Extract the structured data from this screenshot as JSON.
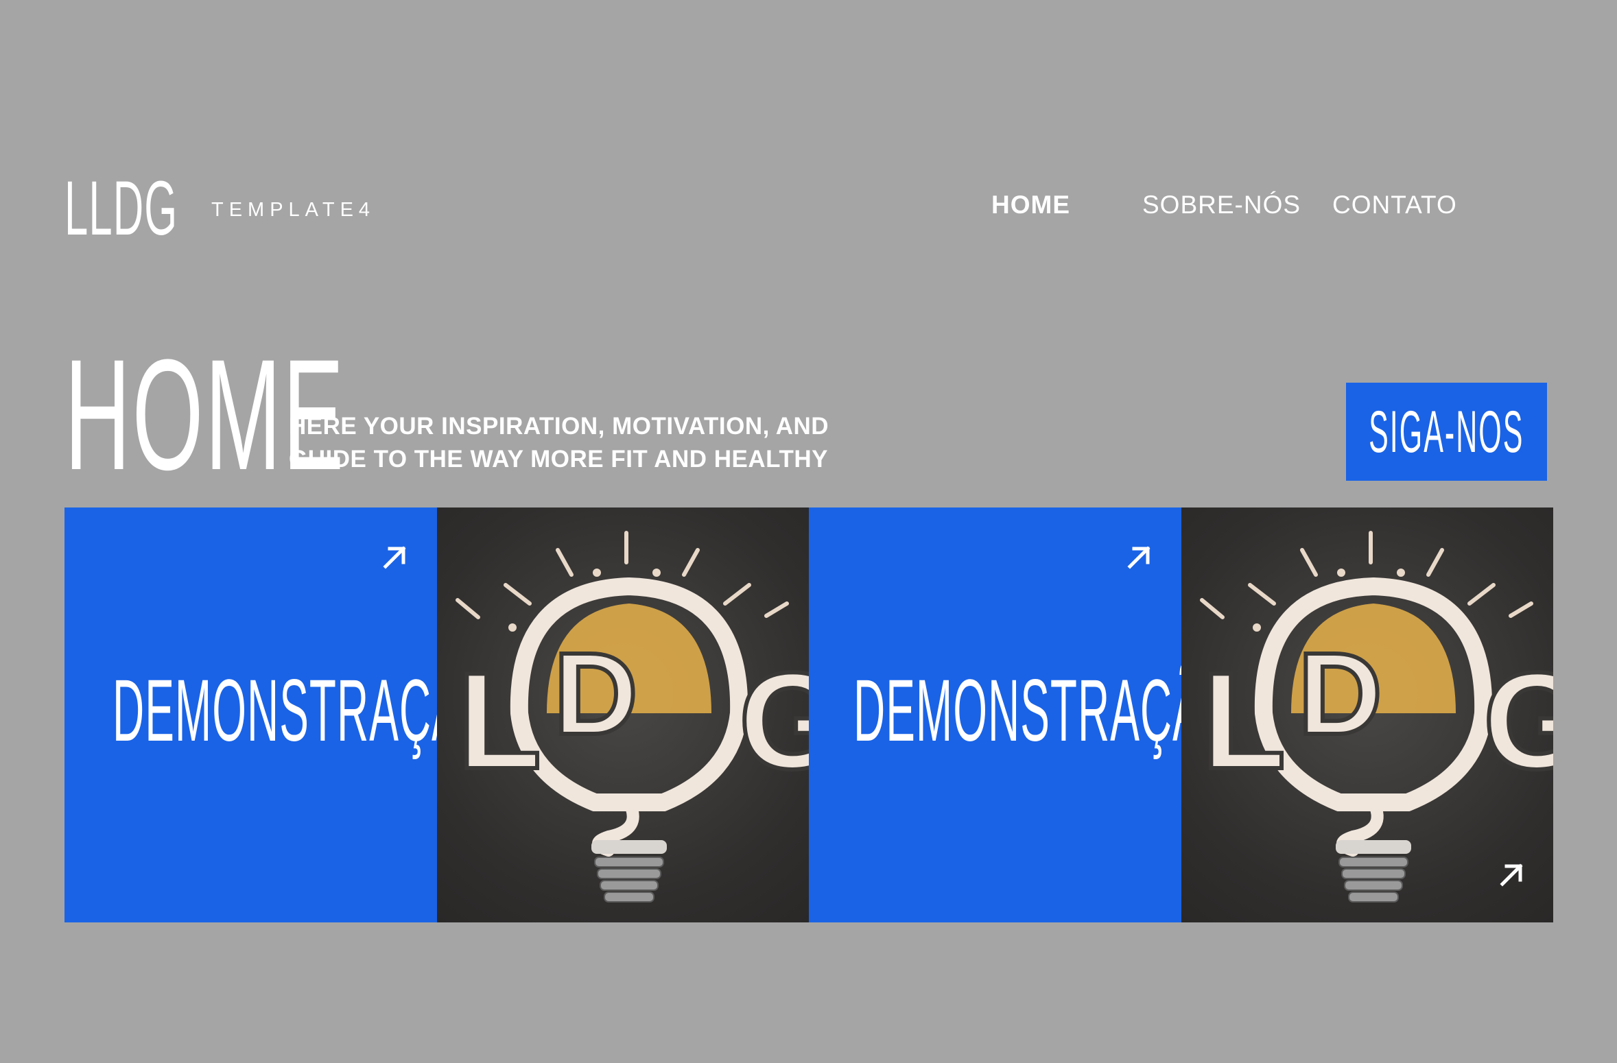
{
  "header": {
    "logo": "LLDG",
    "tagline": "TEMPLATE4",
    "nav": [
      {
        "label": "HOME",
        "active": true
      },
      {
        "label": "SOBRE-NÓS",
        "active": false
      },
      {
        "label": "CONTATO",
        "active": false
      }
    ]
  },
  "hero": {
    "title": "HOME",
    "subtitle_line1": "HERE YOUR INSPIRATION, MOTIVATION, AND",
    "subtitle_line2": "GUIDE TO THE WAY MORE FIT AND HEALTHY",
    "cta_label": "SIGA-NOS"
  },
  "tiles": [
    {
      "label": "DEMONSTRAÇÃO",
      "icon": "arrow-up-right-icon"
    },
    {
      "image": "lldg-lightbulb-logo"
    },
    {
      "label": "DEMONSTRAÇÃO",
      "icon": "arrow-up-right-icon"
    },
    {
      "image": "lldg-lightbulb-logo",
      "icon": "arrow-up-right-icon"
    }
  ],
  "colors": {
    "background": "#a5a5a5",
    "accent": "#1a63e6",
    "text": "#ffffff"
  }
}
